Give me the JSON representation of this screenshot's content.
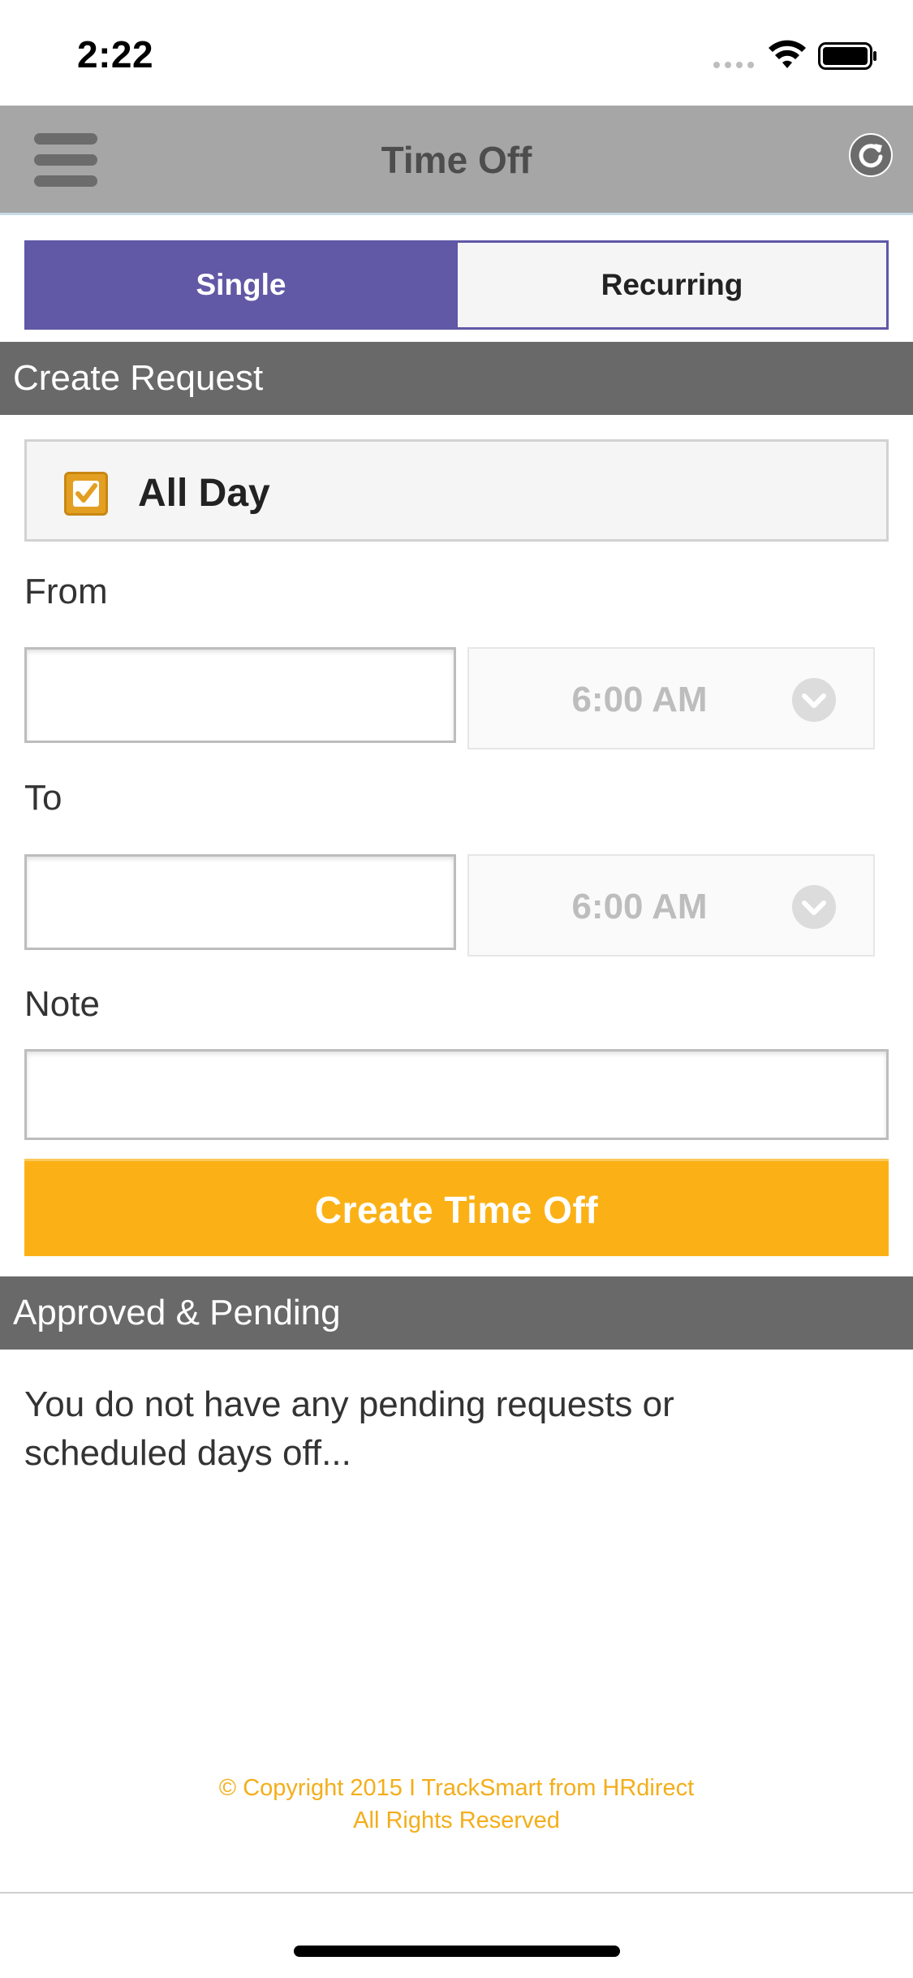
{
  "status_bar": {
    "time": "2:22",
    "signal_icon": "cellular-signal-icon",
    "wifi_icon": "wifi-icon",
    "battery_icon": "battery-icon"
  },
  "nav": {
    "title": "Time Off",
    "menu_icon": "hamburger-menu-icon",
    "refresh_icon": "refresh-icon"
  },
  "segment": {
    "single_label": "Single",
    "recurring_label": "Recurring",
    "selected": "Single"
  },
  "create_request": {
    "header": "Create Request",
    "all_day_label": "All Day",
    "all_day_checked": true,
    "from_label": "From",
    "from_date_value": "",
    "from_time": "6:00 AM",
    "to_label": "To",
    "to_date_value": "",
    "to_time": "6:00 AM",
    "note_label": "Note",
    "note_value": "",
    "create_button": "Create Time Off"
  },
  "approved_pending": {
    "header": "Approved & Pending",
    "empty_message": "You do not have any pending requests or scheduled days off..."
  },
  "footer": {
    "line1": "© Copyright 2015 I TrackSmart from HRdirect",
    "line2": "All Rights Reserved"
  },
  "colors": {
    "accent_purple": "#6159a6",
    "accent_orange": "#fbb116",
    "nav_gray": "#a6a6a6",
    "section_gray": "#696969"
  }
}
